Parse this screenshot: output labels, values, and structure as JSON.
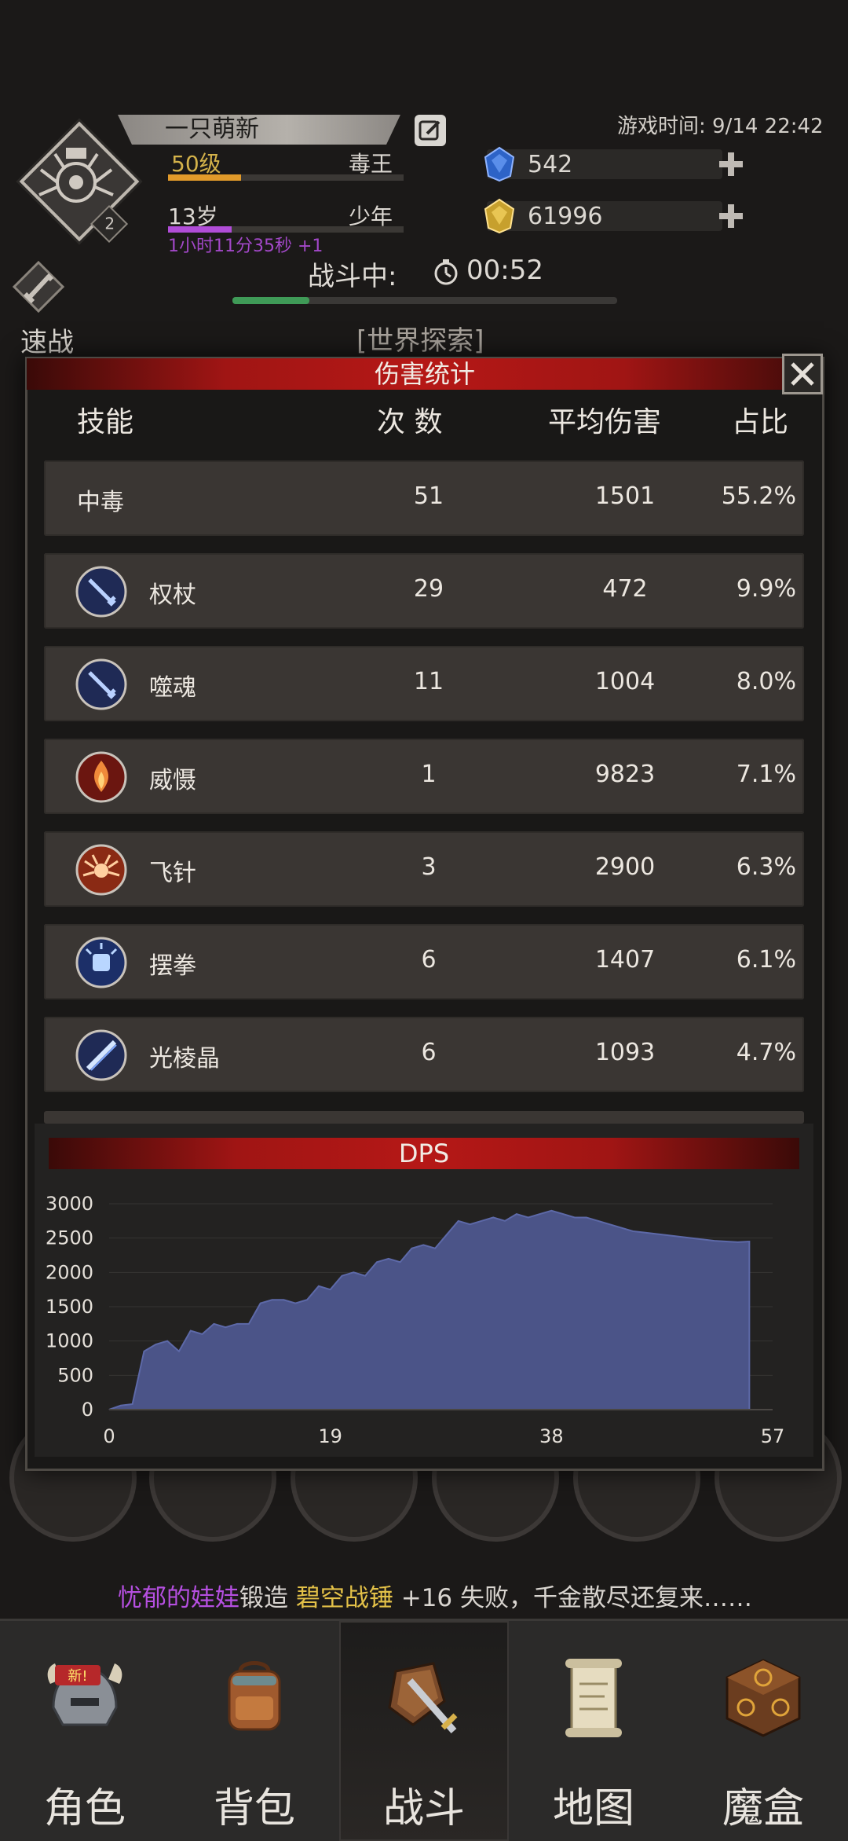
{
  "header": {
    "player_name": "一只萌新",
    "level_label": "50级",
    "level_class": "毒王",
    "level_progress": 0.31,
    "age_label": "13岁",
    "age_class": "少年",
    "age_progress": 0.27,
    "age_timer": "1小时11分35秒 +1",
    "avatar_badge": "2",
    "game_time": "游戏时间: 9/14 22:42",
    "gem_count": "542",
    "gold_count": "61996",
    "battle_status": "战斗中:",
    "battle_time": "00:52",
    "battle_progress": 0.2,
    "quick_label": "速战",
    "location": "[世界探索]"
  },
  "modal": {
    "title": "伤害统计",
    "columns": {
      "skill": "技能",
      "count": "次 数",
      "avg": "平均伤害",
      "pct": "占比"
    },
    "rows": [
      {
        "name": "中毒",
        "count": "51",
        "avg": "1501",
        "pct": "55.2%",
        "icon": ""
      },
      {
        "name": "权杖",
        "count": "29",
        "avg": "472",
        "pct": "9.9%",
        "icon": "sword-icon"
      },
      {
        "name": "噬魂",
        "count": "11",
        "avg": "1004",
        "pct": "8.0%",
        "icon": "sword-icon"
      },
      {
        "name": "威慑",
        "count": "1",
        "avg": "9823",
        "pct": "7.1%",
        "icon": "flame-icon"
      },
      {
        "name": "飞针",
        "count": "3",
        "avg": "2900",
        "pct": "6.3%",
        "icon": "spider-icon"
      },
      {
        "name": "摆拳",
        "count": "6",
        "avg": "1407",
        "pct": "6.1%",
        "icon": "fist-icon"
      },
      {
        "name": "光棱晶",
        "count": "6",
        "avg": "1093",
        "pct": "4.7%",
        "icon": "crystal-icon"
      }
    ],
    "dps_title": "DPS"
  },
  "chart_data": {
    "type": "area",
    "title": "DPS",
    "x": [
      0,
      1,
      2,
      3,
      4,
      5,
      6,
      7,
      8,
      9,
      10,
      11,
      12,
      13,
      14,
      15,
      16,
      17,
      18,
      19,
      20,
      21,
      22,
      23,
      24,
      25,
      26,
      27,
      28,
      29,
      30,
      31,
      32,
      33,
      34,
      35,
      36,
      37,
      38,
      39,
      40,
      41,
      42,
      43,
      44,
      45,
      46,
      47,
      48,
      49,
      50,
      51,
      52,
      53,
      54,
      55
    ],
    "values": [
      0,
      60,
      80,
      850,
      950,
      1000,
      850,
      1150,
      1100,
      1250,
      1200,
      1250,
      1250,
      1550,
      1600,
      1600,
      1550,
      1600,
      1800,
      1750,
      1950,
      2000,
      1950,
      2150,
      2200,
      2150,
      2350,
      2400,
      2350,
      2550,
      2750,
      2700,
      2750,
      2800,
      2750,
      2850,
      2800,
      2850,
      2900,
      2850,
      2800,
      2800,
      2750,
      2700,
      2650,
      2600,
      2580,
      2560,
      2540,
      2520,
      2500,
      2480,
      2460,
      2450,
      2440,
      2450
    ],
    "xticks": [
      0,
      19,
      38,
      57
    ],
    "yticks": [
      0,
      500,
      1000,
      1500,
      2000,
      2500,
      3000
    ],
    "xlim": [
      0,
      57
    ],
    "ylim": [
      0,
      3000
    ],
    "fill_color": "#4b5488",
    "line_color": "#5d69a8"
  },
  "ticker": {
    "who": "忧郁的娃娃",
    "verb": "锻造",
    "item": "碧空战锤",
    "rest": " +16 失败，千金散尽还复来……"
  },
  "nav": {
    "items": [
      {
        "label": "角色",
        "icon": "helmet-icon"
      },
      {
        "label": "背包",
        "icon": "backpack-icon"
      },
      {
        "label": "战斗",
        "icon": "sword-shield-icon"
      },
      {
        "label": "地图",
        "icon": "scroll-map-icon"
      },
      {
        "label": "魔盒",
        "icon": "magic-box-icon"
      }
    ],
    "badge": "新!"
  }
}
